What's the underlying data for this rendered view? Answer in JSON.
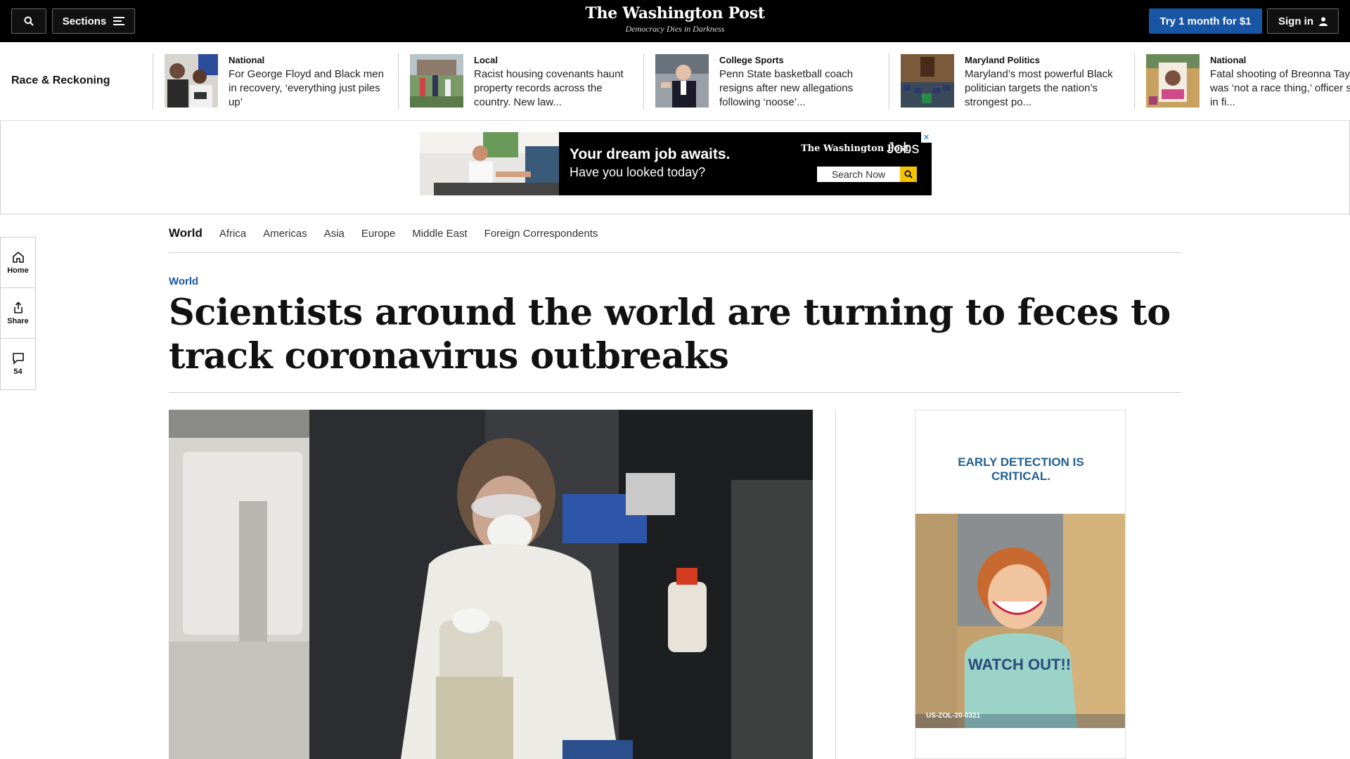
{
  "topbar": {
    "search_icon": "search-icon",
    "sections_label": "Sections",
    "logo_name": "The Washington Post",
    "logo_tagline": "Democracy Dies in Darkness",
    "subscribe_label": "Try 1 month for $1",
    "signin_label": "Sign in"
  },
  "strip": {
    "title": "Race & Reckoning",
    "items": [
      {
        "kicker": "National",
        "headline": "For George Floyd and Black men in recovery, ‘everything just piles up’"
      },
      {
        "kicker": "Local",
        "headline": "Racist housing covenants haunt property records across the country. New law..."
      },
      {
        "kicker": "College Sports",
        "headline": "Penn State basketball coach resigns after new allegations following ‘noose’..."
      },
      {
        "kicker": "Maryland Politics",
        "headline": "Maryland’s most powerful Black politician targets the nation’s strongest po..."
      },
      {
        "kicker": "National",
        "headline": "Fatal shooting of Breonna Taylor was ‘not a race thing,’ officer says in fi..."
      }
    ]
  },
  "ad_banner": {
    "headline": "Your dream job awaits.",
    "subline": "Have you looked today?",
    "logo": "The Washington Post",
    "jobs": "Jobs",
    "search_label": "Search Now"
  },
  "section_nav": {
    "main": "World",
    "links": [
      "Africa",
      "Americas",
      "Asia",
      "Europe",
      "Middle East",
      "Foreign Correspondents"
    ]
  },
  "rail": {
    "home_label": "Home",
    "share_label": "Share",
    "comments_count": "54"
  },
  "article": {
    "kicker": "World",
    "headline": "Scientists around the world are turning to feces to track coronavirus outbreaks"
  },
  "side_ad": {
    "title_line1": "EARLY DETECTION IS",
    "title_line2": "CRITICAL.",
    "shirt_text": "WATCH OUT!!",
    "code": "US-ZOL-20-0321"
  },
  "colors": {
    "accent_blue": "#1955a5",
    "topbar_bg": "#000000",
    "side_ad_title": "#1f5f93"
  }
}
